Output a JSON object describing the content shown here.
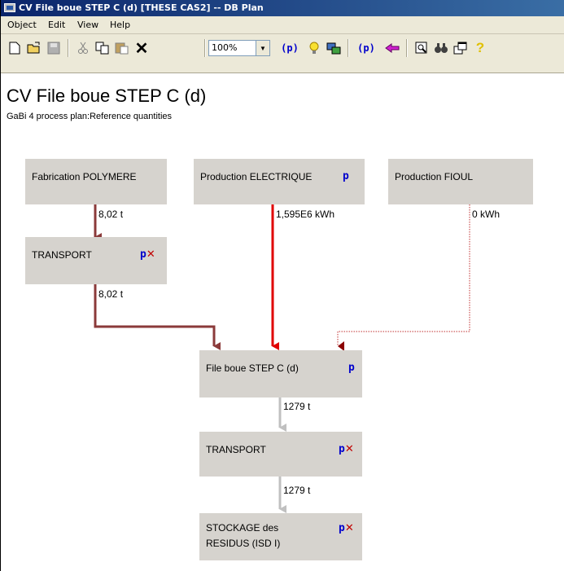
{
  "window": {
    "title": "CV File boue STEP C (d) [THESE CAS2] -- DB Plan"
  },
  "menu": [
    "Object",
    "Edit",
    "View",
    "Help"
  ],
  "toolbar": {
    "zoom": "100%",
    "icons": [
      "new-icon",
      "open-icon",
      "save-icon",
      "cut-icon",
      "copy-icon",
      "paste-icon",
      "delete-icon",
      "zoom-select",
      "parameter-icon",
      "bulb-icon",
      "process-icon",
      "parameter-explorer-icon",
      "flow-icon",
      "inspect-icon",
      "find-icon",
      "windows-icon",
      "help-icon"
    ],
    "param_label": "(p)",
    "param2_label": "(p)"
  },
  "plan": {
    "title": "CV File boue STEP C (d)",
    "subtitle": "GaBi 4 process plan:Reference quantities"
  },
  "processes": {
    "fabrication": {
      "label": "Fabrication POLYMERE"
    },
    "electrique": {
      "label": "Production ELECTRIQUE",
      "flag_p": "p"
    },
    "fioul": {
      "label": "Production FIOUL"
    },
    "transport1": {
      "label": "TRANSPORT",
      "flag_p": "p",
      "flag_x": "✕"
    },
    "fileboue": {
      "label": "File boue STEP C (d)",
      "flag_p": "p"
    },
    "transport2": {
      "label": "TRANSPORT",
      "flag_p": "p",
      "flag_x": "✕"
    },
    "stockage": {
      "label_line1": "STOCKAGE des",
      "label_line2": "RESIDUS (ISD I)",
      "flag_p": "p",
      "flag_x": "✕"
    }
  },
  "flows": {
    "polymere_to_transport": "8,02 t",
    "transport_to_fileboue": "8,02 t",
    "electricite": "1,595E6 kWh",
    "fioul": "0 kWh",
    "fileboue_to_transport": "1279 t",
    "transport_to_stockage": "1279 t"
  },
  "colors": {
    "titlebar": "#0a246a",
    "process_box": "#d6d3ce",
    "flow_brown": "#8b3a3a",
    "flow_red": "#e00000",
    "flow_dark_red": "#8b0000",
    "flow_grey": "#c0c0c0"
  }
}
